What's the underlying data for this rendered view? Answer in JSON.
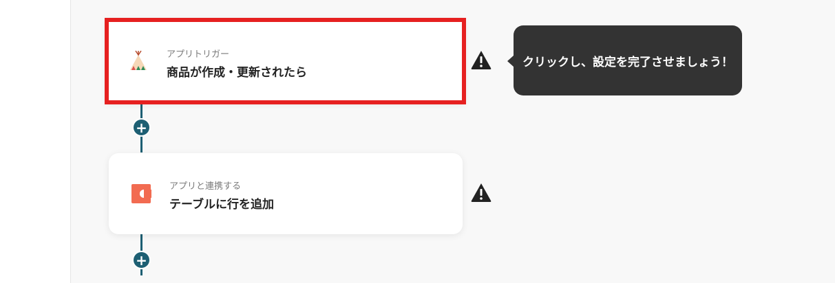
{
  "flow": {
    "steps": [
      {
        "subtitle": "アプリトリガー",
        "title": "商品が作成・更新されたら",
        "icon": "teepee-app-icon"
      },
      {
        "subtitle": "アプリと連携する",
        "title": "テーブルに行を追加",
        "icon": "coda-app-icon"
      }
    ],
    "add_step_symbol": "+"
  },
  "tooltip": {
    "text": "クリックし、設定を完了させましょう！"
  },
  "colors": {
    "connector": "#1d5f73",
    "highlight": "#e62020",
    "tooltip_bg": "#333333",
    "warning": "#222222"
  }
}
